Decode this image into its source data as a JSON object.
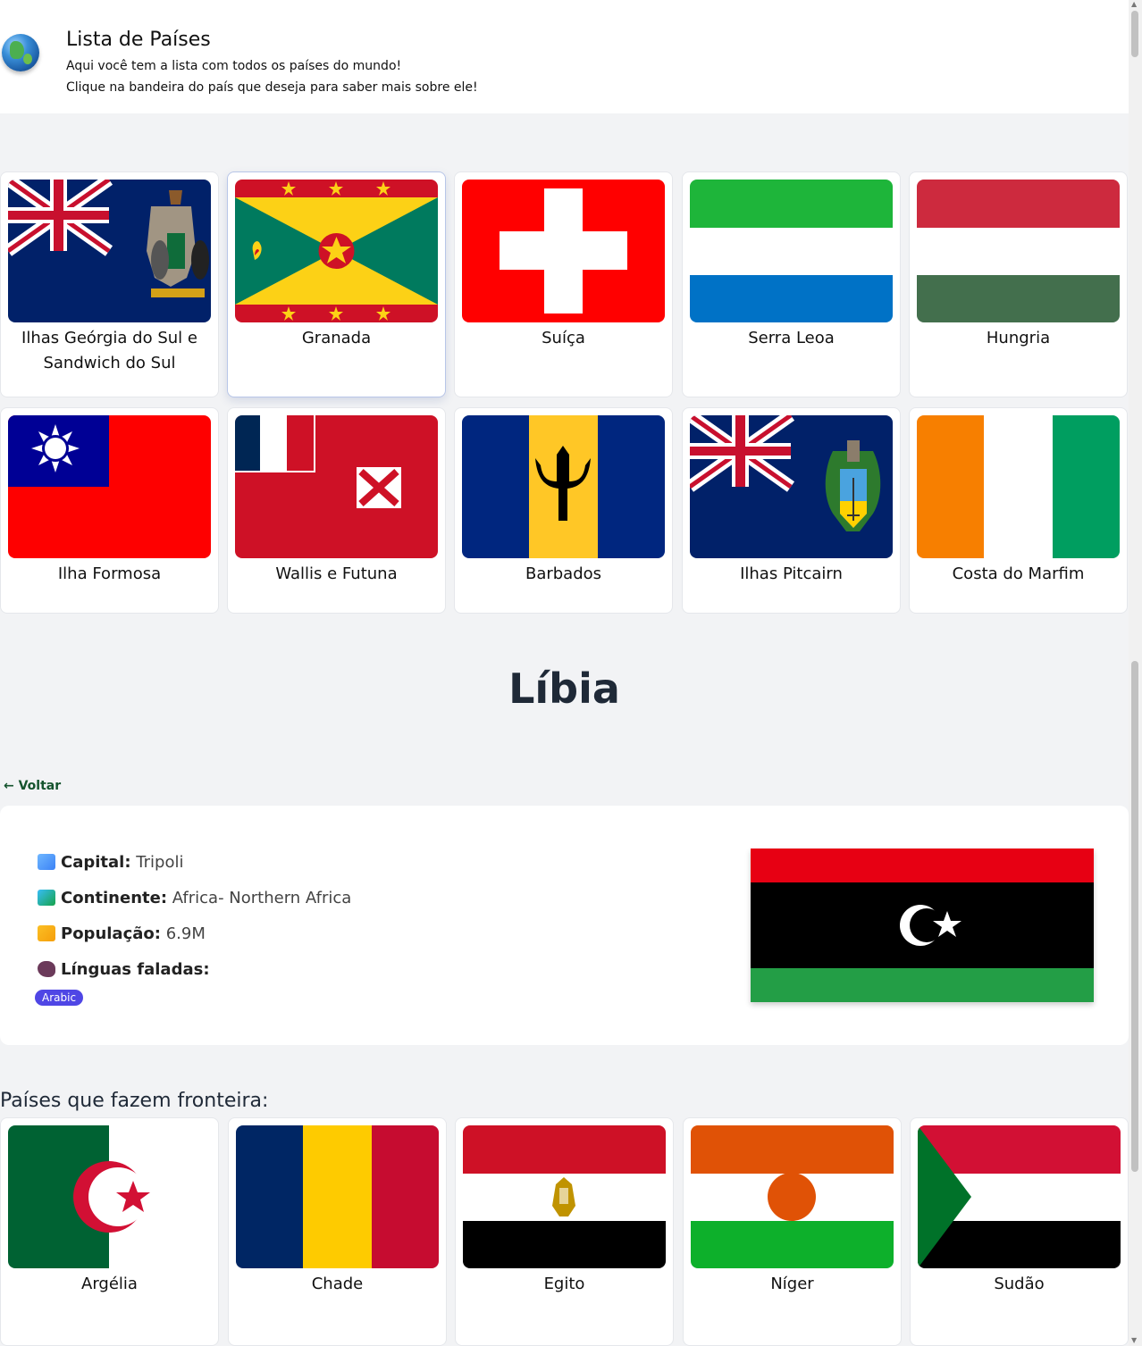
{
  "header": {
    "title": "Lista de Países",
    "subtitle_1": "Aqui você tem a lista com todos os países do mundo!",
    "subtitle_2": "Clique na bandeira do país que deseja para saber mais sobre ele!",
    "logo_icon": "globe-icon"
  },
  "countries": [
    {
      "name": "Ilhas Geórgia do Sul e Sandwich do Sul",
      "flag": "south-georgia"
    },
    {
      "name": "Granada",
      "flag": "grenada"
    },
    {
      "name": "Suíça",
      "flag": "switzerland"
    },
    {
      "name": "Serra Leoa",
      "flag": "sierra-leone"
    },
    {
      "name": "Hungria",
      "flag": "hungary"
    },
    {
      "name": "Ilha Formosa",
      "flag": "taiwan"
    },
    {
      "name": "Wallis e Futuna",
      "flag": "wallis-futuna"
    },
    {
      "name": "Barbados",
      "flag": "barbados"
    },
    {
      "name": "Ilhas Pitcairn",
      "flag": "pitcairn"
    },
    {
      "name": "Costa do Marfim",
      "flag": "ivory-coast"
    }
  ],
  "detail": {
    "country": "Líbia",
    "back_label": "← Voltar",
    "capital_label": "Capital:",
    "capital_value": "Tripoli",
    "continent_label": "Continente:",
    "continent_value": "Africa- Northern Africa",
    "population_label": "População:",
    "population_value": "6.9M",
    "languages_label": "Línguas faladas:",
    "languages": [
      "Arabic"
    ],
    "flag": "libya"
  },
  "borders": {
    "title": "Países que fazem fronteira:",
    "items": [
      {
        "name": "Argélia",
        "flag": "algeria"
      },
      {
        "name": "Chade",
        "flag": "chad"
      },
      {
        "name": "Egito",
        "flag": "egypt"
      },
      {
        "name": "Níger",
        "flag": "niger"
      },
      {
        "name": "Sudão",
        "flag": "sudan"
      }
    ]
  },
  "colors": {
    "badge": "#4f46e5",
    "back_link": "#14532d",
    "page_bg": "#f2f3f5"
  }
}
